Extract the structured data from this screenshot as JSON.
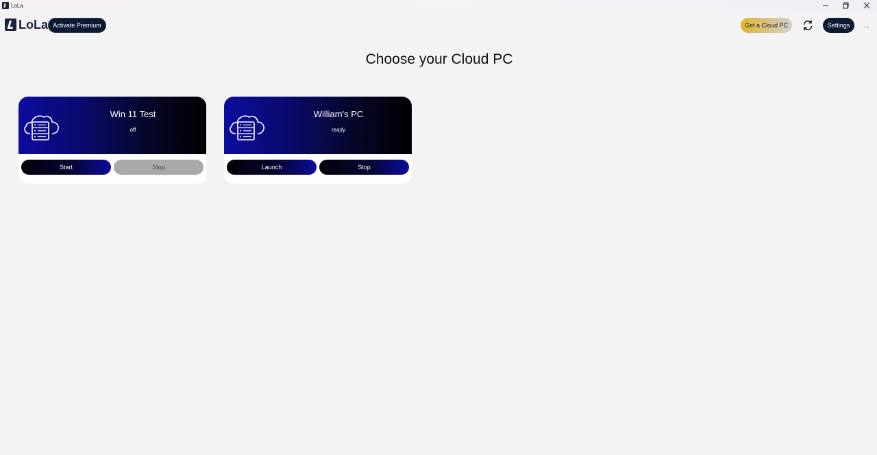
{
  "window": {
    "title": "LoLa",
    "controls": {
      "minimize": "—",
      "restore": "❐",
      "close": "✕"
    }
  },
  "header": {
    "brand": "LoLa",
    "activate_premium": "Activate Premium",
    "get_cloud_pc": "Get a Cloud PC",
    "settings": "Settings",
    "more": "..."
  },
  "main": {
    "heading": "Choose your Cloud PC",
    "cards": [
      {
        "name": "Win 11 Test",
        "status": "off",
        "primary": "Start",
        "secondary": "Stop",
        "secondary_disabled": true
      },
      {
        "name": "William's PC",
        "status": "ready",
        "primary": "Launch",
        "secondary": "Stop",
        "secondary_disabled": false
      }
    ]
  },
  "colors": {
    "background": "#f3f3f3",
    "navy": "#0c1a33",
    "gold": "#e3b52a",
    "card_blue": "#0c0ca0",
    "disabled": "#a9a9a9"
  }
}
